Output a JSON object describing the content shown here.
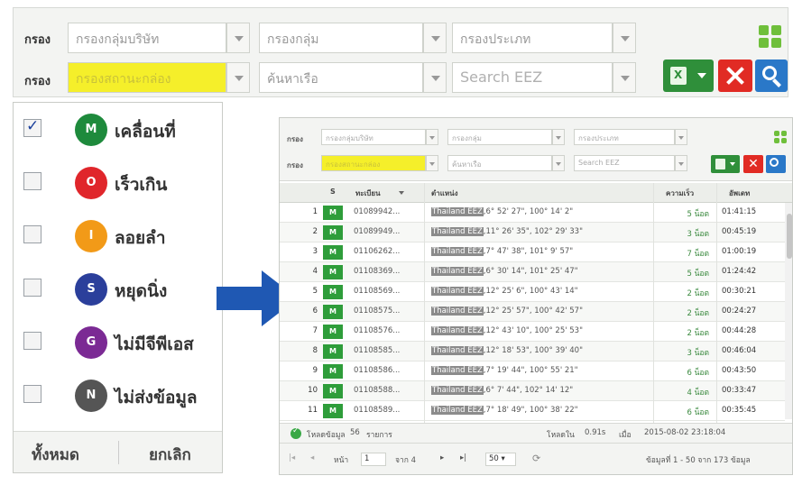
{
  "filters": {
    "row1": {
      "label": "กรอง",
      "company_placeholder": "กรองกลุ่มบริษัท",
      "group_placeholder": "กรองกลุ่ม",
      "type_placeholder": "กรองประเภท"
    },
    "row2": {
      "label": "กรอง",
      "status_placeholder": "กรองสถานะกล่อง",
      "ship_placeholder": "ค้นหาเรือ",
      "eez_placeholder": "Search EEZ"
    }
  },
  "legend": {
    "items": [
      {
        "badge": "M",
        "label": "เคลื่อนที่",
        "checked": true,
        "color": "#1e8a3c"
      },
      {
        "badge": "O",
        "label": "เร็วเกิน",
        "checked": false,
        "color": "#e0262b"
      },
      {
        "badge": "I",
        "label": "ลอยลำ",
        "checked": false,
        "color": "#f29a18"
      },
      {
        "badge": "S",
        "label": "หยุดนิ่ง",
        "checked": false,
        "color": "#2b3f9b"
      },
      {
        "badge": "G",
        "label": "ไม่มีจีพีเอส",
        "checked": false,
        "color": "#7b2a94"
      },
      {
        "badge": "N",
        "label": "ไม่ส่งข้อมูล",
        "checked": false,
        "color": "#555555"
      }
    ],
    "select_all": "ทั้งหมด",
    "cancel": "ยกเลิก"
  },
  "preview": {
    "headers": {
      "status": "S",
      "id": "ทะเบียน",
      "location": "ตำแหน่ง",
      "speed": "ความเร็ว",
      "time": "อัพเดท"
    },
    "rows": [
      {
        "n": "1",
        "s": "M",
        "id": "01089942...",
        "tag": "Thailand EEZ",
        "coord": ",6° 52' 27\", 100° 14' 2\"",
        "speed": "5 น็อต",
        "time": "01:41:15"
      },
      {
        "n": "2",
        "s": "M",
        "id": "01089949...",
        "tag": "Thailand EEZ",
        "coord": ",11° 26' 35\", 102° 29' 33\"",
        "speed": "3 น็อต",
        "time": "00:45:19"
      },
      {
        "n": "3",
        "s": "M",
        "id": "01106262...",
        "tag": "Thailand EEZ",
        "coord": ",7° 47' 38\", 101° 9' 57\"",
        "speed": "7 น็อต",
        "time": "01:00:19"
      },
      {
        "n": "4",
        "s": "M",
        "id": "01108369...",
        "tag": "Thailand EEZ",
        "coord": ",6° 30' 14\", 101° 25' 47\"",
        "speed": "5 น็อต",
        "time": "01:24:42"
      },
      {
        "n": "5",
        "s": "M",
        "id": "01108569...",
        "tag": "Thailand EEZ",
        "coord": ",12° 25' 6\", 100° 43' 14\"",
        "speed": "2 น็อต",
        "time": "00:30:21"
      },
      {
        "n": "6",
        "s": "M",
        "id": "01108575...",
        "tag": "Thailand EEZ",
        "coord": ",12° 25' 57\", 100° 42' 57\"",
        "speed": "2 น็อต",
        "time": "00:24:27"
      },
      {
        "n": "7",
        "s": "M",
        "id": "01108576...",
        "tag": "Thailand EEZ",
        "coord": ",12° 43' 10\", 100° 25' 53\"",
        "speed": "2 น็อต",
        "time": "00:44:28"
      },
      {
        "n": "8",
        "s": "M",
        "id": "01108585...",
        "tag": "Thailand EEZ",
        "coord": ",12° 18' 53\", 100° 39' 40\"",
        "speed": "3 น็อต",
        "time": "00:46:04"
      },
      {
        "n": "9",
        "s": "M",
        "id": "01108586...",
        "tag": "Thailand EEZ",
        "coord": ",7° 19' 44\", 100° 55' 21\"",
        "speed": "6 น็อต",
        "time": "00:43:50"
      },
      {
        "n": "10",
        "s": "M",
        "id": "01108588...",
        "tag": "Thailand EEZ",
        "coord": ",6° 7' 44\", 102° 14' 12\"",
        "speed": "4 น็อต",
        "time": "00:33:47"
      },
      {
        "n": "11",
        "s": "M",
        "id": "01108589...",
        "tag": "Thailand EEZ",
        "coord": ",7° 18' 49\", 100° 38' 22\"",
        "speed": "6 น็อต",
        "time": "00:35:45"
      }
    ],
    "status_bar": {
      "loaded_label": "โหลดข้อมูล",
      "loaded_count": "56",
      "loaded_unit": "รายการ",
      "load_time_label": "โหลดใน",
      "load_time": "0.91s",
      "update_label": "เมื่อ",
      "timestamp": "2015-08-02 23:18:04"
    },
    "pager": {
      "page_label": "หน้า",
      "page_value": "1",
      "of_label": "จาก 4",
      "per_page": "50",
      "summary": "ข้อมูลที่ 1 - 50 จาก 173 ข้อมูล"
    }
  },
  "colors": {
    "accent_green": "#2e9d3a",
    "highlight_yellow": "#f5ef2a",
    "arrow_blue": "#1f58b3"
  }
}
